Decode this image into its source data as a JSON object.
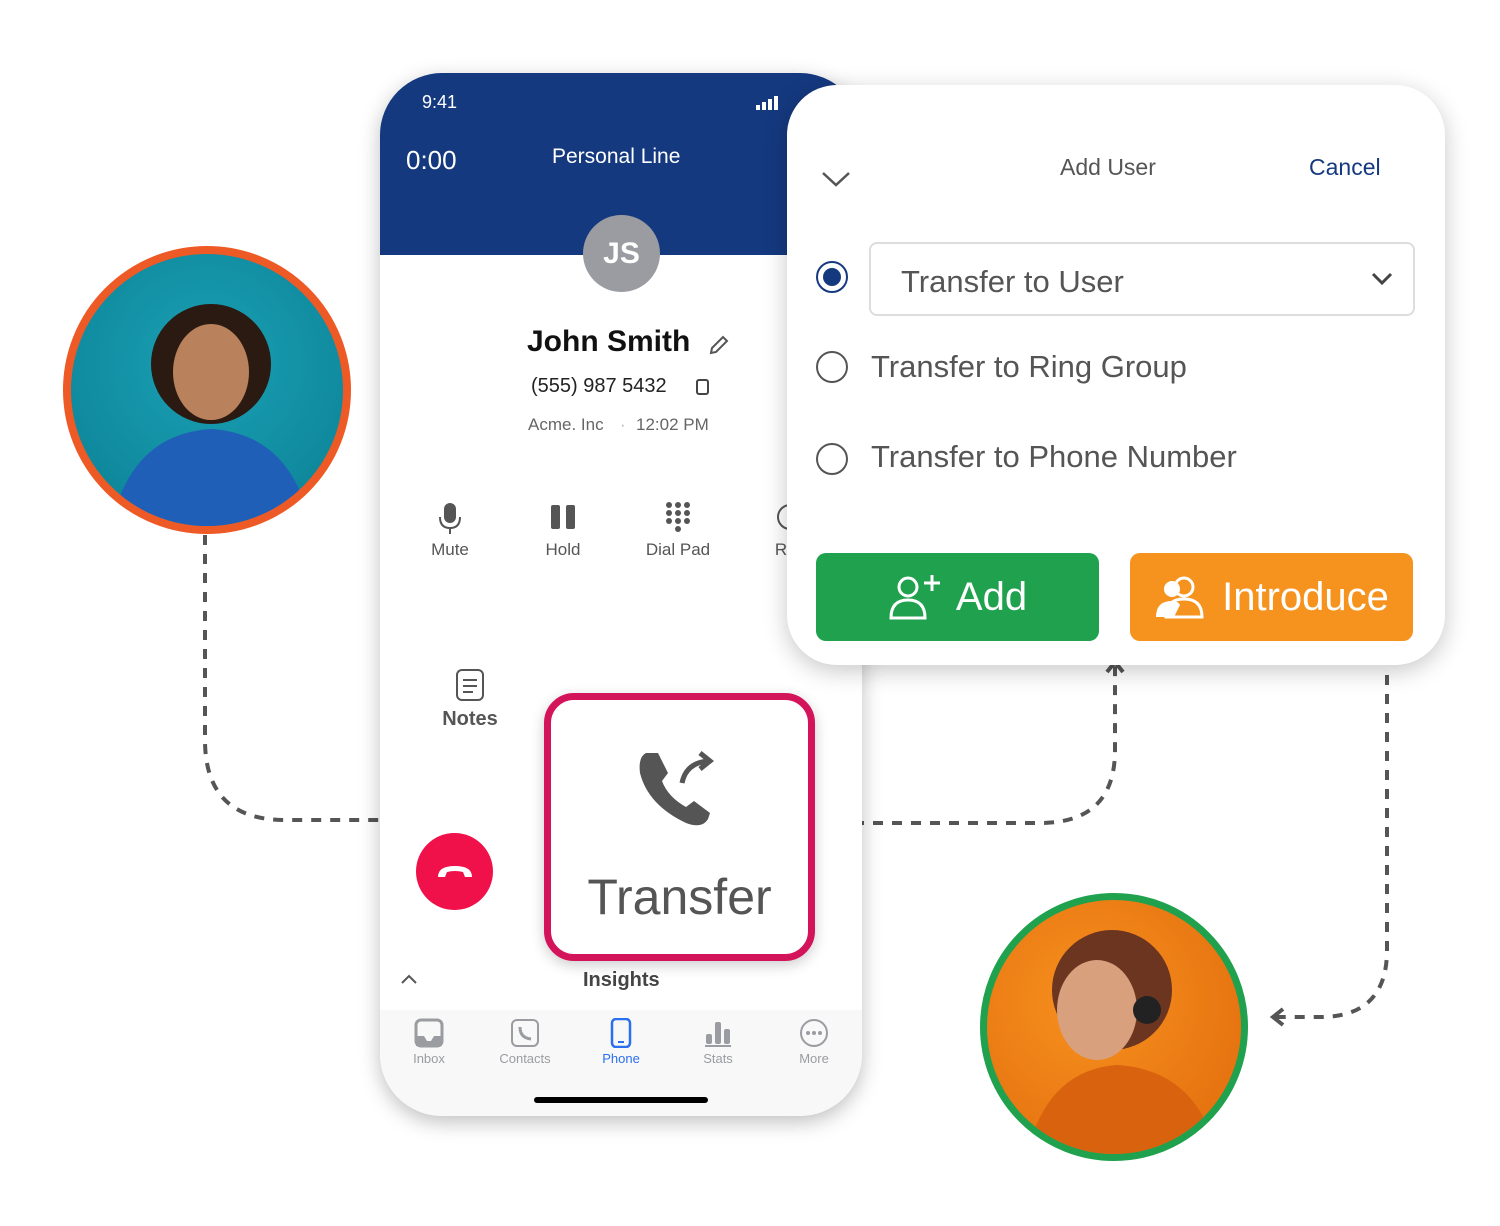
{
  "status_bar": {
    "time": "9:41"
  },
  "call": {
    "timer": "0:00",
    "line": "Personal Line",
    "initials": "JS",
    "name": "John Smith",
    "phone": "(555) 987 5432",
    "company": "Acme. Inc",
    "time": "12:02 PM"
  },
  "controls": [
    {
      "label": "Mute",
      "icon": "microphone-icon"
    },
    {
      "label": "Hold",
      "icon": "pause-icon"
    },
    {
      "label": "Dial Pad",
      "icon": "dialpad-icon"
    },
    {
      "label": "Rec",
      "icon": "record-icon"
    }
  ],
  "notes_label": "Notes",
  "transfer_label": "Transfer",
  "insights_label": "Insights",
  "tabs": [
    {
      "label": "Inbox"
    },
    {
      "label": "Contacts"
    },
    {
      "label": "Phone",
      "active": true
    },
    {
      "label": "Stats"
    },
    {
      "label": "More"
    }
  ],
  "popup": {
    "title": "Add User",
    "cancel": "Cancel",
    "options": [
      "Transfer to User",
      "Transfer to Ring Group",
      "Transfer to Phone Number"
    ],
    "selected": 0,
    "add": "Add",
    "introduce": "Introduce"
  },
  "colors": {
    "header": "#15397f",
    "accent": "#2a6ff0",
    "add": "#1fa14d",
    "introduce": "#f5931e",
    "end_call": "#f0104a",
    "transfer_border": "#d4145a",
    "ring_left": "#ee5a26",
    "ring_right": "#1fa14d"
  }
}
